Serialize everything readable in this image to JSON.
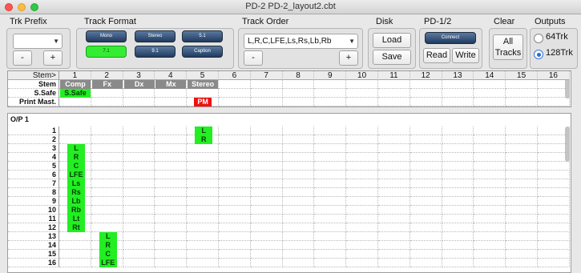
{
  "window": {
    "title": "PD-2  PD-2_layout2.cbt"
  },
  "sections": {
    "trk_prefix": "Trk Prefix",
    "track_format": "Track Format",
    "track_order": "Track Order",
    "disk": "Disk",
    "pd12": "PD-1/2",
    "clear": "Clear",
    "outputs": "Outputs"
  },
  "trk_prefix": {
    "value": "",
    "minus": "-",
    "plus": "+"
  },
  "track_format": {
    "buttons": [
      {
        "label": "Mono",
        "active": false
      },
      {
        "label": "Stereo",
        "active": false
      },
      {
        "label": "5.1",
        "active": false
      },
      {
        "label": "7.1",
        "active": true
      },
      {
        "label": "9.1",
        "active": false
      },
      {
        "label": "Caption",
        "active": false
      }
    ]
  },
  "track_order": {
    "value": "L,R,C,LFE,Ls,Rs,Lb,Rb",
    "minus": "-",
    "plus": "+"
  },
  "disk": {
    "load": "Load",
    "save": "Save"
  },
  "pd12": {
    "connect": "Connect",
    "read": "Read",
    "write": "Write"
  },
  "clear": {
    "all": "All",
    "tracks": "Tracks"
  },
  "outputs": {
    "options": [
      "64Trk",
      "128Trk"
    ],
    "selected": "128Trk"
  },
  "stem_grid": {
    "corner": "Stem>",
    "columns": [
      "1",
      "2",
      "3",
      "4",
      "5",
      "6",
      "7",
      "8",
      "9",
      "10",
      "11",
      "12",
      "13",
      "14",
      "15",
      "16"
    ],
    "rows": [
      {
        "label": "Stem",
        "cells": {
          "1": "Comp",
          "2": "Fx",
          "3": "Dx",
          "4": "Mx",
          "5": "Stereo"
        }
      },
      {
        "label": "S.Safe",
        "cells": {
          "1": "S.Safe"
        }
      },
      {
        "label": "Print Mast.",
        "cells": {
          "5": "PM"
        }
      }
    ]
  },
  "output_grid": {
    "title": "O/P 1",
    "rows": [
      {
        "n": "1",
        "cells": {
          "5": "L"
        }
      },
      {
        "n": "2",
        "cells": {
          "5": "R"
        }
      },
      {
        "n": "3",
        "cells": {
          "1": "L"
        }
      },
      {
        "n": "4",
        "cells": {
          "1": "R"
        }
      },
      {
        "n": "5",
        "cells": {
          "1": "C"
        }
      },
      {
        "n": "6",
        "cells": {
          "1": "LFE"
        }
      },
      {
        "n": "7",
        "cells": {
          "1": "Ls"
        }
      },
      {
        "n": "8",
        "cells": {
          "1": "Rs"
        }
      },
      {
        "n": "9",
        "cells": {
          "1": "Lb"
        }
      },
      {
        "n": "10",
        "cells": {
          "1": "Rb"
        }
      },
      {
        "n": "11",
        "cells": {
          "1": "Lt"
        }
      },
      {
        "n": "12",
        "cells": {
          "1": "Rt"
        }
      },
      {
        "n": "13",
        "cells": {
          "2": "L"
        }
      },
      {
        "n": "14",
        "cells": {
          "2": "R"
        }
      },
      {
        "n": "15",
        "cells": {
          "2": "C"
        }
      },
      {
        "n": "16",
        "cells": {
          "2": "LFE"
        }
      }
    ]
  },
  "colors": {
    "assigned": "#22ee22",
    "stem_header": "#8a8a8a",
    "print_master": "#ef1111"
  }
}
